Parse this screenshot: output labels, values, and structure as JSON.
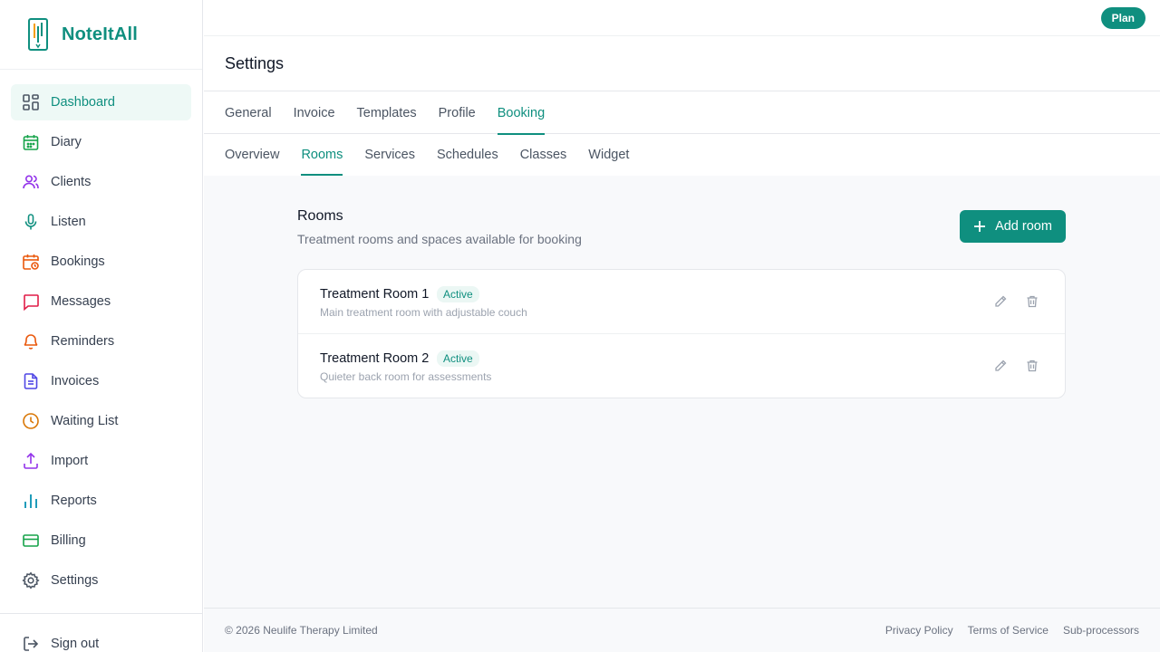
{
  "app": {
    "name": "NoteItAll"
  },
  "topbar": {
    "plan_label": "Plan"
  },
  "sidebar": {
    "items": [
      {
        "label": "Dashboard",
        "icon": "dashboard-icon",
        "color": "#4b5563",
        "active": true
      },
      {
        "label": "Diary",
        "icon": "calendar-icon",
        "color": "#16a34a"
      },
      {
        "label": "Clients",
        "icon": "users-icon",
        "color": "#9333ea"
      },
      {
        "label": "Listen",
        "icon": "microphone-icon",
        "color": "#0f8f7f"
      },
      {
        "label": "Bookings",
        "icon": "calendar-clock-icon",
        "color": "#ea580c"
      },
      {
        "label": "Messages",
        "icon": "message-icon",
        "color": "#e11d48"
      },
      {
        "label": "Reminders",
        "icon": "bell-icon",
        "color": "#ea580c"
      },
      {
        "label": "Invoices",
        "icon": "document-icon",
        "color": "#4f46e5"
      },
      {
        "label": "Waiting List",
        "icon": "clock-icon",
        "color": "#d97706"
      },
      {
        "label": "Import",
        "icon": "upload-icon",
        "color": "#9333ea"
      },
      {
        "label": "Reports",
        "icon": "bar-chart-icon",
        "color": "#0891b2"
      },
      {
        "label": "Billing",
        "icon": "credit-card-icon",
        "color": "#16a34a"
      },
      {
        "label": "Settings",
        "icon": "gear-icon",
        "color": "#4b5563"
      }
    ],
    "signout_label": "Sign out"
  },
  "page": {
    "title": "Settings"
  },
  "tabs": [
    "General",
    "Invoice",
    "Templates",
    "Profile",
    "Booking"
  ],
  "active_tab": "Booking",
  "subtabs": [
    "Overview",
    "Rooms",
    "Services",
    "Schedules",
    "Classes",
    "Widget"
  ],
  "active_subtab": "Rooms",
  "rooms_section": {
    "title": "Rooms",
    "subtitle": "Treatment rooms and spaces available for booking",
    "add_label": "Add room",
    "rooms": [
      {
        "name": "Treatment Room 1",
        "status": "Active",
        "description": "Main treatment room with adjustable couch"
      },
      {
        "name": "Treatment Room 2",
        "status": "Active",
        "description": "Quieter back room for assessments"
      }
    ]
  },
  "footer": {
    "copyright": "© 2026 Neulife Therapy Limited",
    "links": [
      "Privacy Policy",
      "Terms of Service",
      "Sub-processors"
    ]
  },
  "colors": {
    "accent": "#0f8f7f",
    "badge_bg": "#ebf7f4"
  }
}
